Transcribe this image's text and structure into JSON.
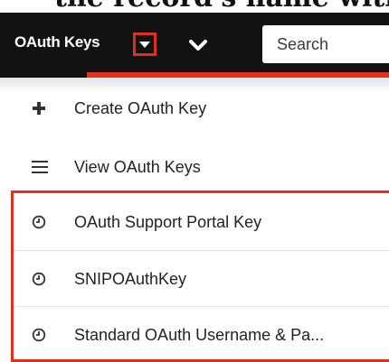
{
  "header": {
    "module_title": "OAuth Keys",
    "search_placeholder": "Search"
  },
  "actions": [
    {
      "label": "Create OAuth Key",
      "icon": "plus-icon"
    },
    {
      "label": "View OAuth Keys",
      "icon": "list-icon"
    }
  ],
  "recently_viewed": [
    {
      "label": "OAuth Support Portal Key",
      "icon": "clock-icon"
    },
    {
      "label": "SNIPOAuthKey",
      "icon": "clock-icon"
    },
    {
      "label": "Standard OAuth Username & Pa...",
      "icon": "clock-icon"
    }
  ],
  "colors": {
    "navbar": "#121212",
    "accent": "#e0301e",
    "text": "#222222"
  }
}
